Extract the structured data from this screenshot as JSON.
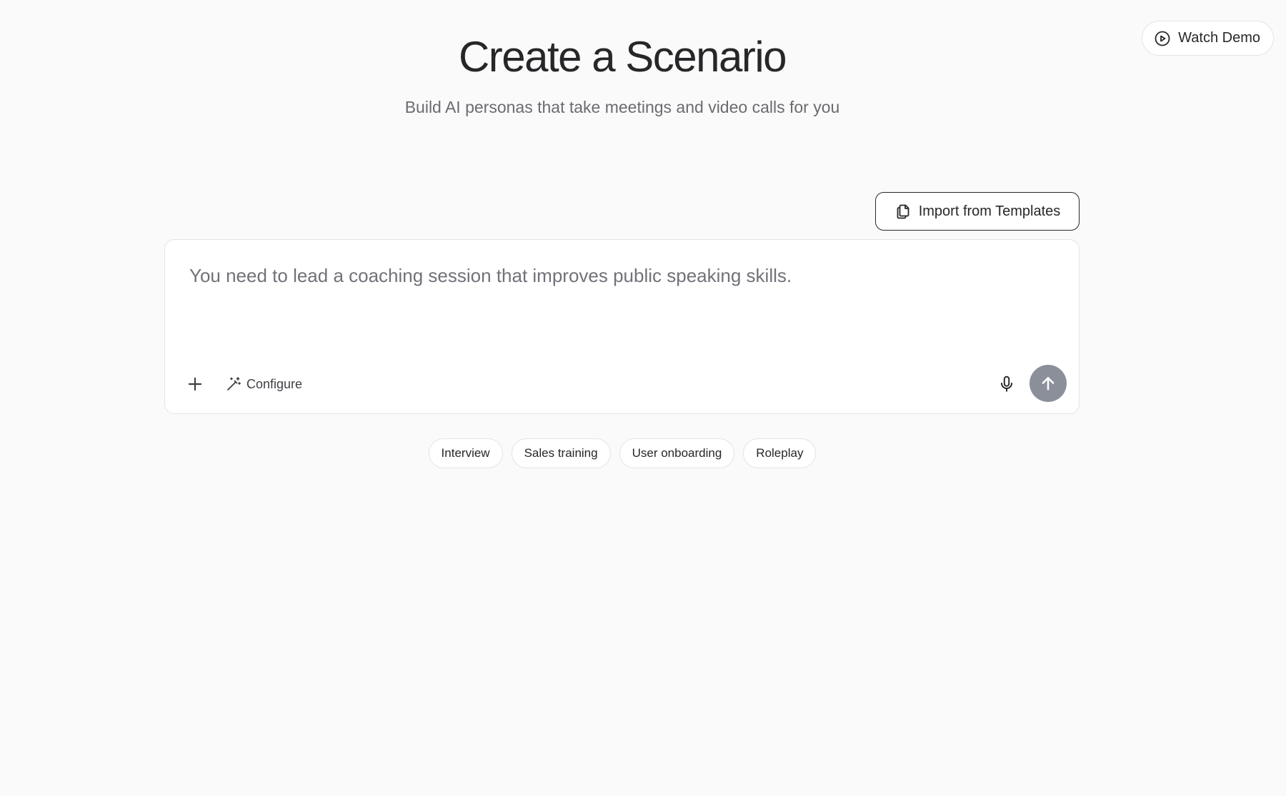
{
  "header": {
    "title": "Create a Scenario",
    "subtitle": "Build AI personas that take meetings and video calls for you"
  },
  "topbar": {
    "watch_demo_label": "Watch Demo",
    "watch_demo_icon": "play-circle-icon"
  },
  "import": {
    "label": "Import from Templates",
    "icon": "copy-icon"
  },
  "composer": {
    "value": "",
    "placeholder": "You need to lead a coaching session that improves public speaking skills.",
    "configure_label": "Configure",
    "icons": {
      "add": "plus-icon",
      "configure": "magic-wand-icon",
      "mic": "microphone-icon",
      "send": "arrow-up-icon"
    },
    "send_color": "#8b8f99"
  },
  "suggestions": [
    {
      "label": "Interview"
    },
    {
      "label": "Sales training"
    },
    {
      "label": "User onboarding"
    },
    {
      "label": "Roleplay"
    }
  ]
}
